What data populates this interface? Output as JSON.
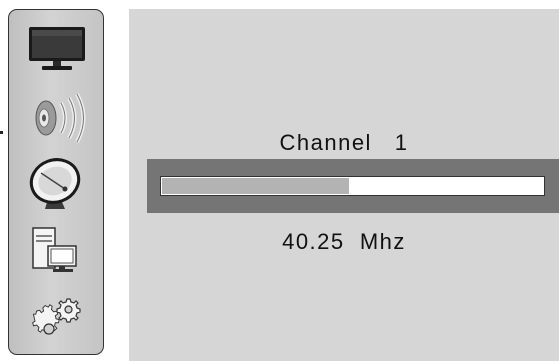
{
  "sidebar": {
    "items": [
      {
        "icon": "tv-icon"
      },
      {
        "icon": "speaker-sound-icon"
      },
      {
        "icon": "satellite-dish-icon"
      },
      {
        "icon": "computer-icon"
      },
      {
        "icon": "gears-icon"
      }
    ]
  },
  "scan": {
    "channel_text": "Channel   1",
    "frequency_text": "40.25  Mhz",
    "progress_fraction": 0.49
  },
  "colors": {
    "panel_background": "#d6d6d6",
    "progress_frame": "#757575",
    "progress_fill": "#b3b3b3",
    "progress_track": "#ffffff"
  }
}
